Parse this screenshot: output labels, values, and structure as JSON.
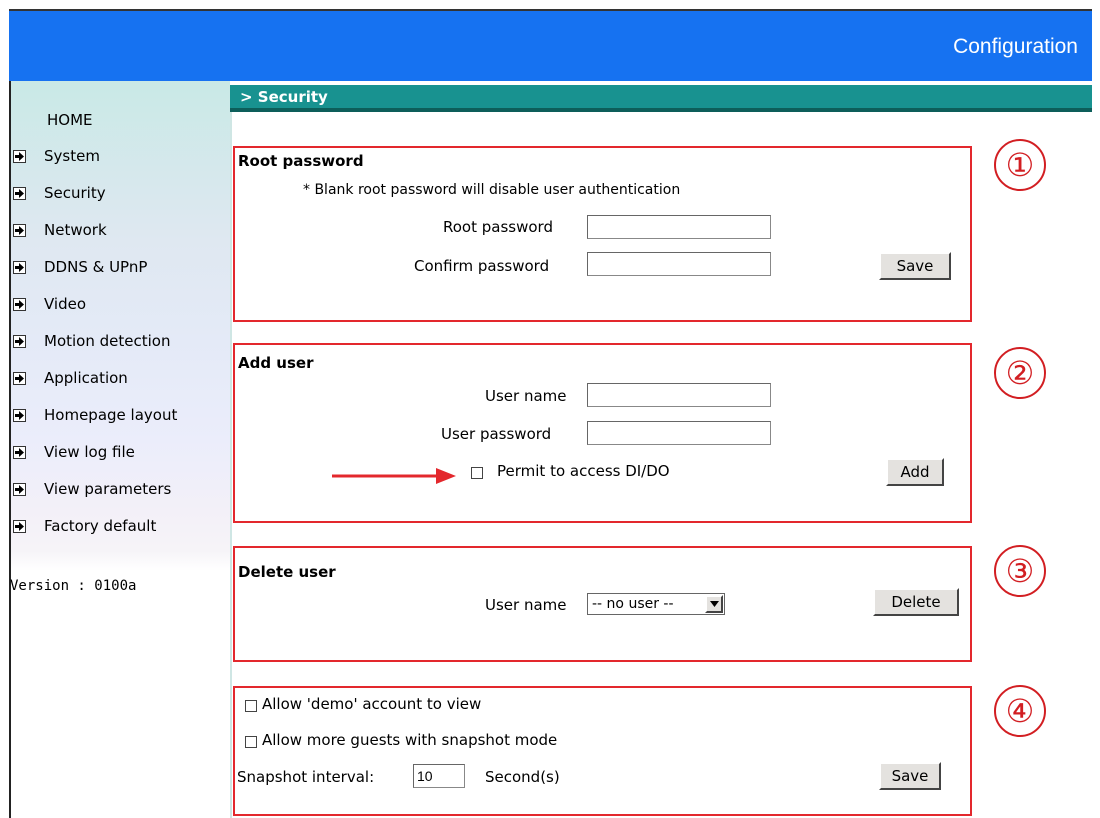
{
  "header": {
    "title": "Configuration"
  },
  "sidebar": {
    "home": "HOME",
    "items": [
      {
        "label": "System"
      },
      {
        "label": "Security"
      },
      {
        "label": "Network"
      },
      {
        "label": "DDNS & UPnP"
      },
      {
        "label": "Video"
      },
      {
        "label": "Motion detection"
      },
      {
        "label": "Application"
      },
      {
        "label": "Homepage layout"
      },
      {
        "label": "View log file"
      },
      {
        "label": "View parameters"
      },
      {
        "label": "Factory default"
      }
    ],
    "version": "Version : 0100a"
  },
  "breadcrumb": "> Security",
  "root_password": {
    "heading": "Root password",
    "note": "* Blank root password will disable user authentication",
    "root_label": "Root password",
    "root_value": "",
    "confirm_label": "Confirm password",
    "confirm_value": "",
    "save_label": "Save",
    "marker": "①"
  },
  "add_user": {
    "heading": "Add user",
    "user_name_label": "User name",
    "user_name_value": "",
    "user_password_label": "User password",
    "user_password_value": "",
    "permit_label": "Permit to access DI/DO",
    "add_label": "Add",
    "marker": "②"
  },
  "delete_user": {
    "heading": "Delete user",
    "user_name_label": "User name",
    "selected_user": "-- no user --",
    "delete_label": "Delete",
    "marker": "③"
  },
  "guest": {
    "allow_demo_label": "Allow 'demo' account to view",
    "allow_guests_label": "Allow more guests with snapshot mode",
    "interval_label": "Snapshot interval:",
    "interval_value": "10",
    "interval_unit": "Second(s)",
    "save_label": "Save",
    "marker": "④"
  },
  "colors": {
    "header": "#1672f1",
    "breadcrumb": "#189290",
    "annotation": "#e3282d"
  }
}
